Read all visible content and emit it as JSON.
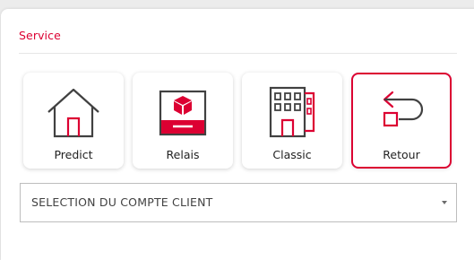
{
  "section": {
    "title": "Service"
  },
  "services": [
    {
      "label": "Predict",
      "icon": "house-icon",
      "selected": false
    },
    {
      "label": "Relais",
      "icon": "parcel-relay-icon",
      "selected": false
    },
    {
      "label": "Classic",
      "icon": "building-icon",
      "selected": false
    },
    {
      "label": "Retour",
      "icon": "return-arrow-icon",
      "selected": true
    }
  ],
  "account_select": {
    "value": "SELECTION DU COMPTE CLIENT"
  },
  "colors": {
    "accent": "#dc0032",
    "icon_stroke": "#414141",
    "text": "#222222"
  }
}
